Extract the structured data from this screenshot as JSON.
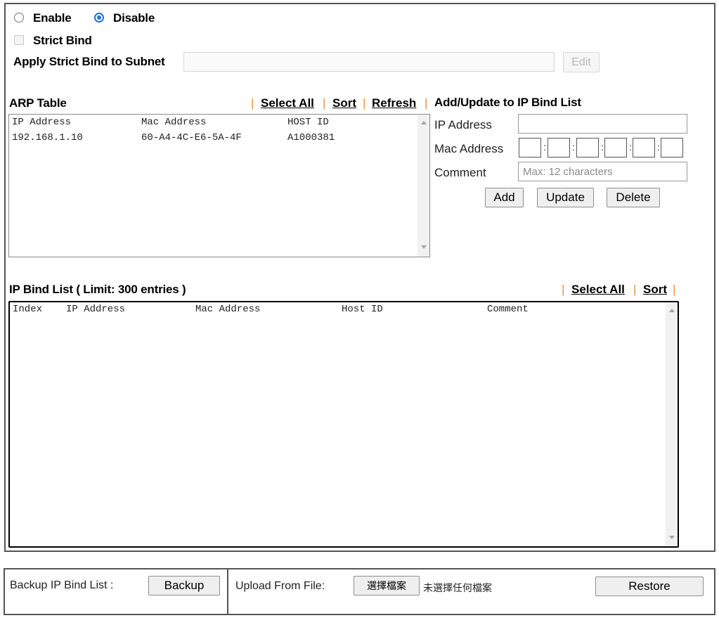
{
  "mode": {
    "options": [
      {
        "label": "Enable",
        "selected": false
      },
      {
        "label": "Disable",
        "selected": true
      }
    ]
  },
  "strict_bind": {
    "label": "Strict Bind",
    "checked": false
  },
  "subnet": {
    "label": "Apply Strict Bind to Subnet",
    "value": "",
    "edit_label": "Edit"
  },
  "arp_table": {
    "title": "ARP Table",
    "links": {
      "select_all": "Select All",
      "sort": "Sort",
      "refresh": "Refresh"
    },
    "separator": "|",
    "columns": [
      "IP Address",
      "Mac Address",
      "HOST ID"
    ],
    "rows": [
      {
        "ip": "192.168.1.10",
        "mac": "60-A4-4C-E6-5A-4F",
        "host": "A1000381"
      }
    ]
  },
  "add_update": {
    "title": "Add/Update to IP Bind List",
    "ip_label": "IP Address",
    "ip_value": "",
    "mac_label": "Mac Address",
    "mac_colon": ":",
    "comment_label": "Comment",
    "comment_placeholder": "Max: 12 characters",
    "buttons": {
      "add": "Add",
      "update": "Update",
      "delete": "Delete"
    }
  },
  "bind_list": {
    "title": "IP Bind List ( Limit: 300 entries )",
    "links": {
      "select_all": "Select All",
      "sort": "Sort"
    },
    "separator": "|",
    "columns": [
      "Index",
      "IP Address",
      "Mac Address",
      "Host ID",
      "Comment"
    ],
    "rows": []
  },
  "backup": {
    "label": "Backup IP Bind List :",
    "button": "Backup"
  },
  "upload": {
    "label": "Upload From File:",
    "choose_button": "選擇檔案",
    "no_file": "未選擇任何檔案",
    "restore_button": "Restore"
  },
  "colors": {
    "radio_accent": "#1a73e8",
    "separator": "#f08a3c"
  }
}
